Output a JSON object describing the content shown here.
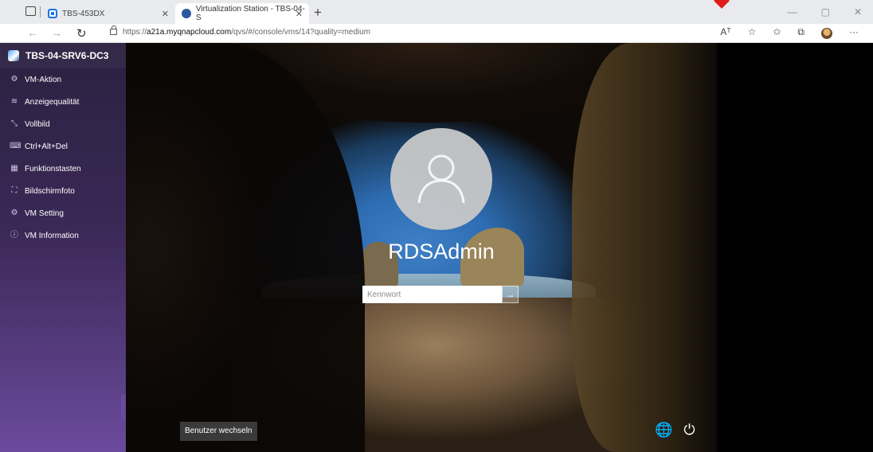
{
  "browser": {
    "tabs": [
      {
        "title": "TBS-453DX"
      },
      {
        "title": "Virtualization Station - TBS-04-S"
      }
    ],
    "url_prefix": "https://",
    "url_host": "a21a.myqnapcloud.com",
    "url_path": "/qvs/#/console/vms/14?quality=medium",
    "read_aloud": "Aᵀ",
    "icons": [
      "tab-actions-icon",
      "back-icon",
      "forward-icon",
      "reload-icon",
      "lock-icon",
      "read-aloud-icon",
      "add-favorite-icon",
      "favorites-icon",
      "collections-icon",
      "profile-icon",
      "more-icon"
    ]
  },
  "sidebar": {
    "vm_name": "TBS-04-SRV6-DC3",
    "items": [
      {
        "label": "VM-Aktion",
        "icon": "vm-action-icon"
      },
      {
        "label": "Anzeigequalität",
        "icon": "display-quality-icon"
      },
      {
        "label": "Vollbild",
        "icon": "fullscreen-icon"
      },
      {
        "label": "Ctrl+Alt+Del",
        "icon": "keyboard-icon"
      },
      {
        "label": "Funktionstasten",
        "icon": "function-keys-icon"
      },
      {
        "label": "Bildschirmfoto",
        "icon": "screenshot-icon"
      },
      {
        "label": "VM Setting",
        "icon": "gear-icon"
      },
      {
        "label": "VM Information",
        "icon": "info-icon"
      }
    ]
  },
  "login": {
    "username": "RDSAdmin",
    "password_placeholder": "Kennwort",
    "switch_user": "Benutzer wechseln"
  }
}
